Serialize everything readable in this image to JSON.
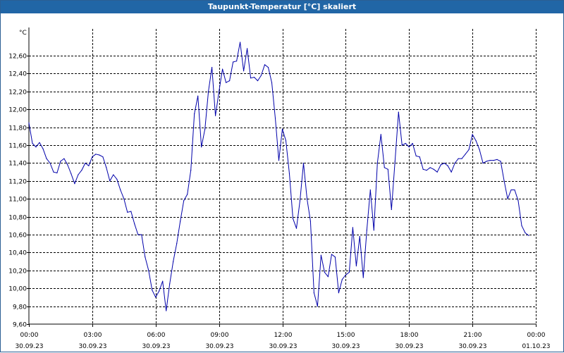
{
  "window": {
    "title": "Taupunkt-Temperatur [°C] skaliert"
  },
  "chart_data": {
    "type": "line",
    "title": "Taupunkt-Temperatur [°C] skaliert",
    "ylabel": "°C",
    "xlabel": "",
    "ylim": [
      9.6,
      12.9
    ],
    "xlim": [
      "30.09.23 00:00",
      "01.10.23 00:00"
    ],
    "grid": true,
    "line_color": "#0000aa",
    "y_ticks": [
      "9,60",
      "9,80",
      "10,00",
      "10,20",
      "10,40",
      "10,60",
      "10,80",
      "11,00",
      "11,20",
      "11,40",
      "11,60",
      "11,80",
      "12,00",
      "12,20",
      "12,40",
      "12,60"
    ],
    "x_ticks": [
      {
        "time": "00:00",
        "date": "30.09.23"
      },
      {
        "time": "03:00",
        "date": "30.09.23"
      },
      {
        "time": "06:00",
        "date": "30.09.23"
      },
      {
        "time": "09:00",
        "date": "30.09.23"
      },
      {
        "time": "12:00",
        "date": "30.09.23"
      },
      {
        "time": "15:00",
        "date": "30.09.23"
      },
      {
        "time": "18:00",
        "date": "30.09.23"
      },
      {
        "time": "21:00",
        "date": "30.09.23"
      },
      {
        "time": "00:00",
        "date": "01.10.23"
      }
    ],
    "series": [
      {
        "points": [
          [
            "30.09.23 00:00",
            11.85
          ],
          [
            "30.09.23 00:10",
            11.62
          ],
          [
            "30.09.23 00:20",
            11.58
          ],
          [
            "30.09.23 00:30",
            11.63
          ],
          [
            "30.09.23 00:40",
            11.56
          ],
          [
            "30.09.23 00:50",
            11.45
          ],
          [
            "30.09.23 01:00",
            11.4
          ],
          [
            "30.09.23 01:10",
            11.3
          ],
          [
            "30.09.23 01:20",
            11.29
          ],
          [
            "30.09.23 01:30",
            11.42
          ],
          [
            "30.09.23 01:40",
            11.45
          ],
          [
            "30.09.23 01:50",
            11.38
          ],
          [
            "30.09.23 02:00",
            11.28
          ],
          [
            "30.09.23 02:10",
            11.17
          ],
          [
            "30.09.23 02:20",
            11.27
          ],
          [
            "30.09.23 02:30",
            11.32
          ],
          [
            "30.09.23 02:40",
            11.4
          ],
          [
            "30.09.23 02:50",
            11.37
          ],
          [
            "30.09.23 03:00",
            11.47
          ],
          [
            "30.09.23 03:10",
            11.5
          ],
          [
            "30.09.23 03:20",
            11.49
          ],
          [
            "30.09.23 03:30",
            11.47
          ],
          [
            "30.09.23 03:40",
            11.35
          ],
          [
            "30.09.23 03:50",
            11.2
          ],
          [
            "30.09.23 04:00",
            11.27
          ],
          [
            "30.09.23 04:10",
            11.22
          ],
          [
            "30.09.23 04:20",
            11.1
          ],
          [
            "30.09.23 04:30",
            11.0
          ],
          [
            "30.09.23 04:40",
            10.85
          ],
          [
            "30.09.23 04:50",
            10.86
          ],
          [
            "30.09.23 05:00",
            10.72
          ],
          [
            "30.09.23 05:10",
            10.6
          ],
          [
            "30.09.23 05:20",
            10.6
          ],
          [
            "30.09.23 05:30",
            10.35
          ],
          [
            "30.09.23 05:40",
            10.2
          ],
          [
            "30.09.23 05:50",
            9.98
          ],
          [
            "30.09.23 06:00",
            9.9
          ],
          [
            "30.09.23 06:10",
            9.97
          ],
          [
            "30.09.23 06:20",
            10.08
          ],
          [
            "30.09.23 06:30",
            9.75
          ],
          [
            "30.09.23 06:40",
            10.05
          ],
          [
            "30.09.23 06:50",
            10.3
          ],
          [
            "30.09.23 07:00",
            10.5
          ],
          [
            "30.09.23 07:10",
            10.75
          ],
          [
            "30.09.23 07:20",
            10.98
          ],
          [
            "30.09.23 07:30",
            11.05
          ],
          [
            "30.09.23 07:40",
            11.32
          ],
          [
            "30.09.23 07:50",
            11.95
          ],
          [
            "30.09.23 08:00",
            12.15
          ],
          [
            "30.09.23 08:10",
            11.58
          ],
          [
            "30.09.23 08:20",
            11.78
          ],
          [
            "30.09.23 08:30",
            12.2
          ],
          [
            "30.09.23 08:40",
            12.47
          ],
          [
            "30.09.23 08:50",
            11.93
          ],
          [
            "30.09.23 09:00",
            12.2
          ],
          [
            "30.09.23 09:10",
            12.45
          ],
          [
            "30.09.23 09:20",
            12.3
          ],
          [
            "30.09.23 09:30",
            12.32
          ],
          [
            "30.09.23 09:40",
            12.53
          ],
          [
            "30.09.23 09:50",
            12.54
          ],
          [
            "30.09.23 10:00",
            12.75
          ],
          [
            "30.09.23 10:10",
            12.43
          ],
          [
            "30.09.23 10:20",
            12.68
          ],
          [
            "30.09.23 10:30",
            12.35
          ],
          [
            "30.09.23 10:40",
            12.36
          ],
          [
            "30.09.23 10:50",
            12.32
          ],
          [
            "30.09.23 11:00",
            12.38
          ],
          [
            "30.09.23 11:10",
            12.5
          ],
          [
            "30.09.23 11:20",
            12.47
          ],
          [
            "30.09.23 11:30",
            12.3
          ],
          [
            "30.09.23 11:40",
            11.9
          ],
          [
            "30.09.23 11:50",
            11.43
          ],
          [
            "30.09.23 12:00",
            11.78
          ],
          [
            "30.09.23 12:10",
            11.65
          ],
          [
            "30.09.23 12:20",
            11.28
          ],
          [
            "30.09.23 12:30",
            10.78
          ],
          [
            "30.09.23 12:40",
            10.67
          ],
          [
            "30.09.23 12:50",
            10.98
          ],
          [
            "30.09.23 13:00",
            11.4
          ],
          [
            "30.09.23 13:10",
            11.0
          ],
          [
            "30.09.23 13:20",
            10.75
          ],
          [
            "30.09.23 13:30",
            9.95
          ],
          [
            "30.09.23 13:40",
            9.8
          ],
          [
            "30.09.23 13:50",
            10.37
          ],
          [
            "30.09.23 14:00",
            10.18
          ],
          [
            "30.09.23 14:10",
            10.13
          ],
          [
            "30.09.23 14:20",
            10.38
          ],
          [
            "30.09.23 14:30",
            10.35
          ],
          [
            "30.09.23 14:40",
            9.95
          ],
          [
            "30.09.23 14:50",
            10.1
          ],
          [
            "30.09.23 15:00",
            10.15
          ],
          [
            "30.09.23 15:10",
            10.18
          ],
          [
            "30.09.23 15:20",
            10.68
          ],
          [
            "30.09.23 15:30",
            10.25
          ],
          [
            "30.09.23 15:40",
            10.58
          ],
          [
            "30.09.23 15:50",
            10.12
          ],
          [
            "30.09.23 16:00",
            10.65
          ],
          [
            "30.09.23 16:10",
            11.1
          ],
          [
            "30.09.23 16:20",
            10.65
          ],
          [
            "30.09.23 16:30",
            11.4
          ],
          [
            "30.09.23 16:40",
            11.72
          ],
          [
            "30.09.23 16:50",
            11.35
          ],
          [
            "30.09.23 17:00",
            11.33
          ],
          [
            "30.09.23 17:10",
            10.88
          ],
          [
            "30.09.23 17:20",
            11.42
          ],
          [
            "30.09.23 17:30",
            11.97
          ],
          [
            "30.09.23 17:40",
            11.6
          ],
          [
            "30.09.23 17:50",
            11.62
          ],
          [
            "30.09.23 18:00",
            11.58
          ],
          [
            "30.09.23 18:10",
            11.62
          ],
          [
            "30.09.23 18:20",
            11.48
          ],
          [
            "30.09.23 18:30",
            11.47
          ],
          [
            "30.09.23 18:40",
            11.33
          ],
          [
            "30.09.23 18:50",
            11.32
          ],
          [
            "30.09.23 19:00",
            11.35
          ],
          [
            "30.09.23 19:10",
            11.33
          ],
          [
            "30.09.23 19:20",
            11.3
          ],
          [
            "30.09.23 19:30",
            11.38
          ],
          [
            "30.09.23 19:40",
            11.4
          ],
          [
            "30.09.23 19:50",
            11.37
          ],
          [
            "30.09.23 20:00",
            11.3
          ],
          [
            "30.09.23 20:10",
            11.4
          ],
          [
            "30.09.23 20:20",
            11.45
          ],
          [
            "30.09.23 20:30",
            11.45
          ],
          [
            "30.09.23 20:40",
            11.5
          ],
          [
            "30.09.23 20:50",
            11.55
          ],
          [
            "30.09.23 21:00",
            11.72
          ],
          [
            "30.09.23 21:10",
            11.65
          ],
          [
            "30.09.23 21:20",
            11.55
          ],
          [
            "30.09.23 21:30",
            11.4
          ],
          [
            "30.09.23 21:40",
            11.42
          ],
          [
            "30.09.23 21:50",
            11.43
          ],
          [
            "30.09.23 22:00",
            11.43
          ],
          [
            "30.09.23 22:10",
            11.44
          ],
          [
            "30.09.23 22:20",
            11.42
          ],
          [
            "30.09.23 22:30",
            11.2
          ],
          [
            "30.09.23 22:40",
            11.0
          ],
          [
            "30.09.23 22:50",
            11.1
          ],
          [
            "30.09.23 23:00",
            11.1
          ],
          [
            "30.09.23 23:10",
            10.98
          ],
          [
            "30.09.23 23:20",
            10.7
          ],
          [
            "30.09.23 23:30",
            10.62
          ],
          [
            "30.09.23 23:40",
            10.59
          ]
        ]
      }
    ]
  }
}
